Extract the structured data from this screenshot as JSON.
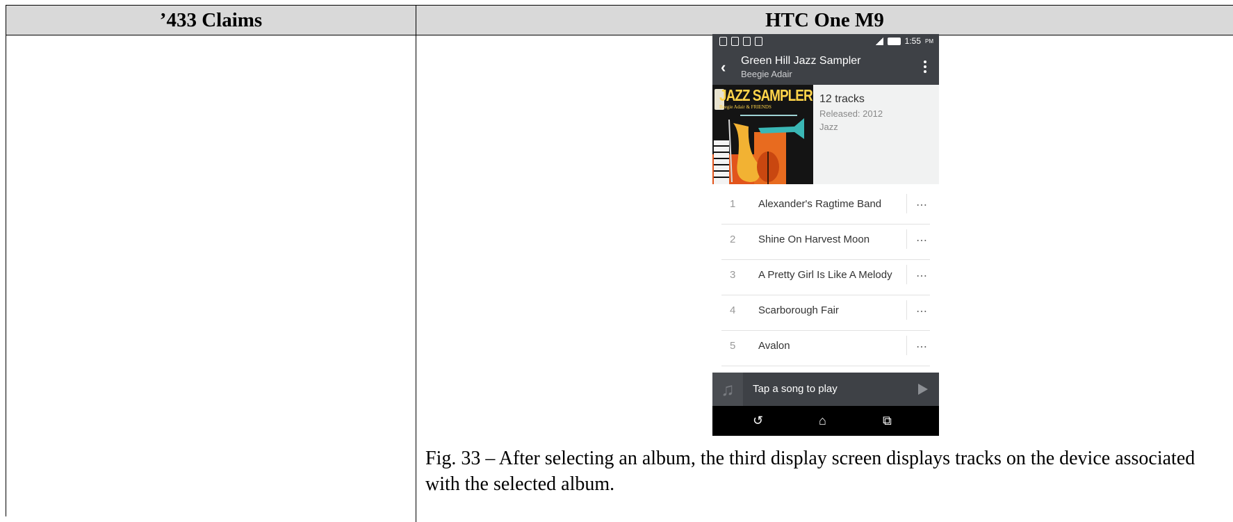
{
  "table": {
    "left_header": "’433 Claims",
    "right_header": "HTC One M9"
  },
  "phone": {
    "status": {
      "time": "1:55",
      "ampm": "PM"
    },
    "appbar": {
      "title": "Green Hill Jazz Sampler",
      "subtitle": "Beegie Adair"
    },
    "album": {
      "art_title": "JAZZ SAMPLER",
      "art_subtitle": "Beegie Adair & FRIENDS",
      "tracks_count": "12 tracks",
      "released": "Released: 2012",
      "genre": "Jazz"
    },
    "tracks": [
      {
        "num": "1",
        "title": "Alexander's Ragtime Band"
      },
      {
        "num": "2",
        "title": "Shine On Harvest Moon"
      },
      {
        "num": "3",
        "title": "A Pretty Girl Is Like A Melody"
      },
      {
        "num": "4",
        "title": "Scarborough Fair"
      },
      {
        "num": "5",
        "title": "Avalon"
      }
    ],
    "track_menu_glyph": "⋯",
    "miniplayer": {
      "text": "Tap a song to play"
    },
    "icons": [
      "back-icon",
      "more-vert-icon",
      "music-note-icon",
      "play-icon",
      "nav-back-icon",
      "nav-home-icon",
      "nav-recents-icon"
    ]
  },
  "caption": "Fig. 33 – After selecting an album, the third display screen displays tracks on the device associated with the selected album."
}
